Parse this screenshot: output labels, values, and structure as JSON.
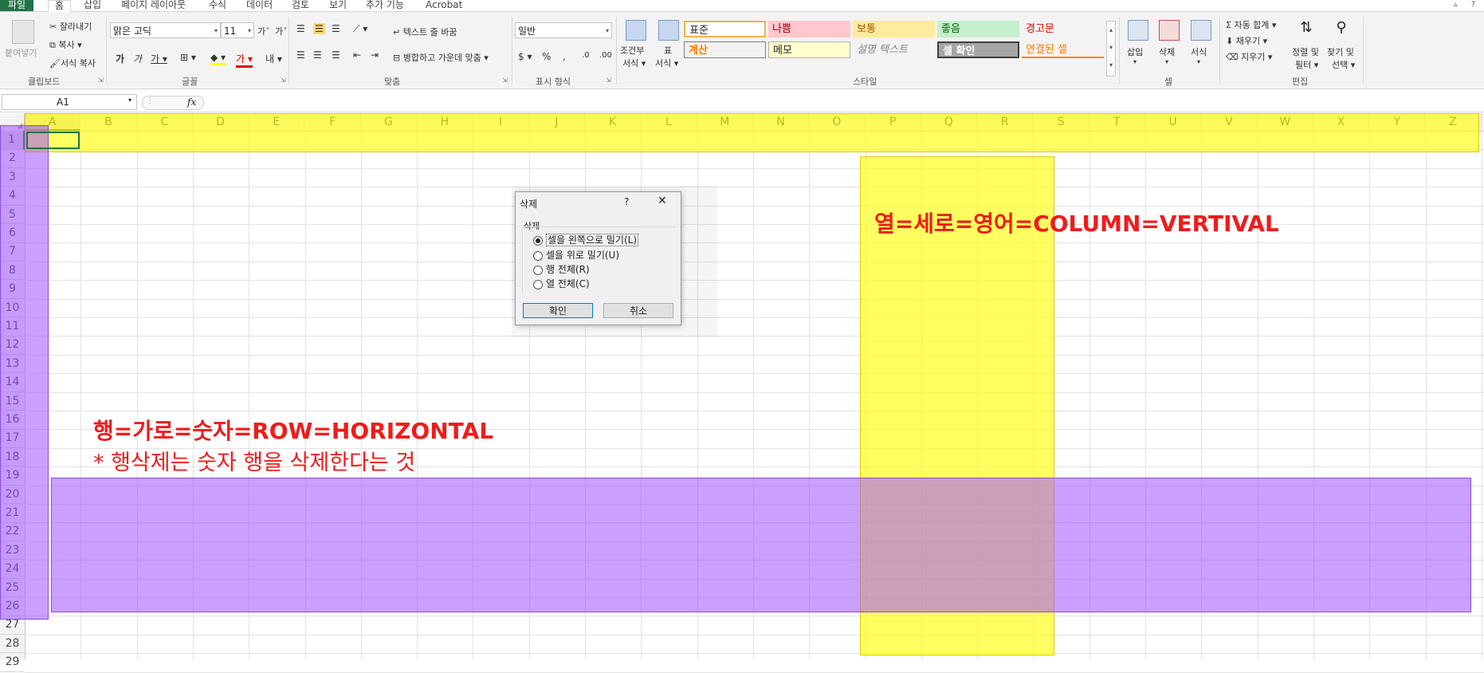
{
  "tabs": [
    "파일",
    "홈",
    "삽입",
    "페이지 레이아웃",
    "수식",
    "데이터",
    "검토",
    "보기",
    "추가 기능",
    "Acrobat"
  ],
  "clipboard": {
    "paste": "붙여넣기",
    "cut": "잘라내기",
    "copy": "복사",
    "format_painter": "서식 복사",
    "label": "클립보드"
  },
  "font": {
    "name": "맑은 고딕",
    "size": "11",
    "label": "글꼴"
  },
  "alignment": {
    "wrap_text": "텍스트 줄 바꿈",
    "merge_center": "병합하고 가운데 맞춤",
    "label": "맞춤"
  },
  "number": {
    "format": "일반",
    "label": "표시 형식"
  },
  "styles": {
    "cond_format_1": "조건부",
    "cond_format_2": "서식",
    "table_format_1": "표",
    "table_format_2": "서식",
    "normal": "표준",
    "bad": "나쁨",
    "neutral": "보통",
    "good": "좋음",
    "warning": "경고문",
    "calculation": "계산",
    "note": "메모",
    "explanatory": "설명 텍스트",
    "check_cell": "셀 확인",
    "linked_cell": "연결된 셀",
    "label": "스타일"
  },
  "cells": {
    "insert": "삽입",
    "delete": "삭제",
    "format": "서식",
    "label": "셀"
  },
  "editing": {
    "autosum": "자동 합계",
    "fill": "채우기",
    "clear": "지우기",
    "sort_1": "정렬 및",
    "sort_2": "필터",
    "find_1": "찾기 및",
    "find_2": "선택",
    "label": "편집"
  },
  "formula_bar": {
    "name_box": "A1",
    "fx": "fx"
  },
  "columns": [
    "A",
    "B",
    "C",
    "D",
    "E",
    "F",
    "G",
    "H",
    "I",
    "J",
    "K",
    "L",
    "M",
    "N",
    "O",
    "P",
    "Q",
    "R",
    "S",
    "T",
    "U",
    "V",
    "W",
    "X",
    "Y",
    "Z"
  ],
  "rows": [
    "1",
    "2",
    "3",
    "4",
    "5",
    "6",
    "7",
    "8",
    "9",
    "10",
    "11",
    "12",
    "13",
    "14",
    "15",
    "16",
    "17",
    "18",
    "19",
    "20",
    "21",
    "22",
    "23",
    "24",
    "25",
    "26",
    "27",
    "28",
    "29"
  ],
  "dialog": {
    "title": "삭제",
    "help": "?",
    "group": "삭제",
    "options": [
      "셀을 왼쪽으로 밀기(L)",
      "셀을 위로 밀기(U)",
      "행 전체(R)",
      "열 전체(C)"
    ],
    "ok": "확인",
    "cancel": "취소"
  },
  "annotations": {
    "column_text": "열=세로=영어=COLUMN=VERTIVAL",
    "row_text": "행=가로=숫자=ROW=HORIZONTAL",
    "row_note": "* 행삭제는 숫자 행을 삭제한다는 것"
  },
  "colors": {
    "accent": "#217346",
    "highlight_yellow": "#ffff00",
    "highlight_purple": "#a050ff",
    "annotation_red": "#ee1c1c"
  }
}
